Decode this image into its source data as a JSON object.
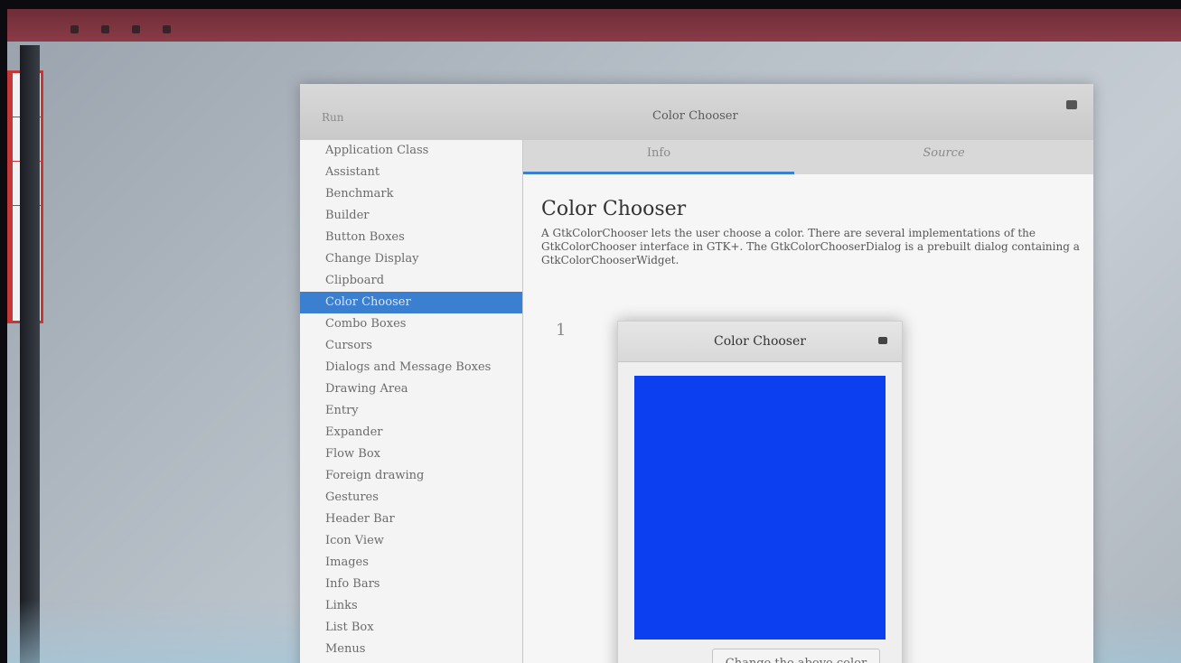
{
  "window": {
    "title": "Color Chooser",
    "run_label": "Run"
  },
  "sidebar": {
    "items": [
      {
        "label": "Application Class"
      },
      {
        "label": "Assistant"
      },
      {
        "label": "Benchmark"
      },
      {
        "label": "Builder"
      },
      {
        "label": "Button Boxes"
      },
      {
        "label": "Change Display"
      },
      {
        "label": "Clipboard"
      },
      {
        "label": "Color Chooser",
        "selected": true
      },
      {
        "label": "Combo Boxes"
      },
      {
        "label": "Cursors"
      },
      {
        "label": "Dialogs and Message Boxes"
      },
      {
        "label": "Drawing Area"
      },
      {
        "label": "Entry"
      },
      {
        "label": "Expander"
      },
      {
        "label": "Flow Box"
      },
      {
        "label": "Foreign drawing"
      },
      {
        "label": "Gestures"
      },
      {
        "label": "Header Bar"
      },
      {
        "label": "Icon View"
      },
      {
        "label": "Images"
      },
      {
        "label": "Info Bars"
      },
      {
        "label": "Links"
      },
      {
        "label": "List Box"
      },
      {
        "label": "Menus"
      }
    ]
  },
  "tabs": [
    {
      "label": "Info",
      "active": true
    },
    {
      "label": "Source",
      "active": false
    }
  ],
  "content": {
    "heading": "Color Chooser",
    "description": "A GtkColorChooser lets the user choose a color. There are several implementations of the GtkColorChooser interface in GTK+. The GtkColorChooserDialog is a prebuilt dialog containing a GtkColorChooserWidget.",
    "line_marker": "1"
  },
  "dialog": {
    "title": "Color Chooser",
    "swatch_color": "#0c3ff0",
    "button_label": "Change the above color"
  },
  "colors": {
    "accent": "#3b7fd0",
    "top_bar": "#8a3b47"
  }
}
